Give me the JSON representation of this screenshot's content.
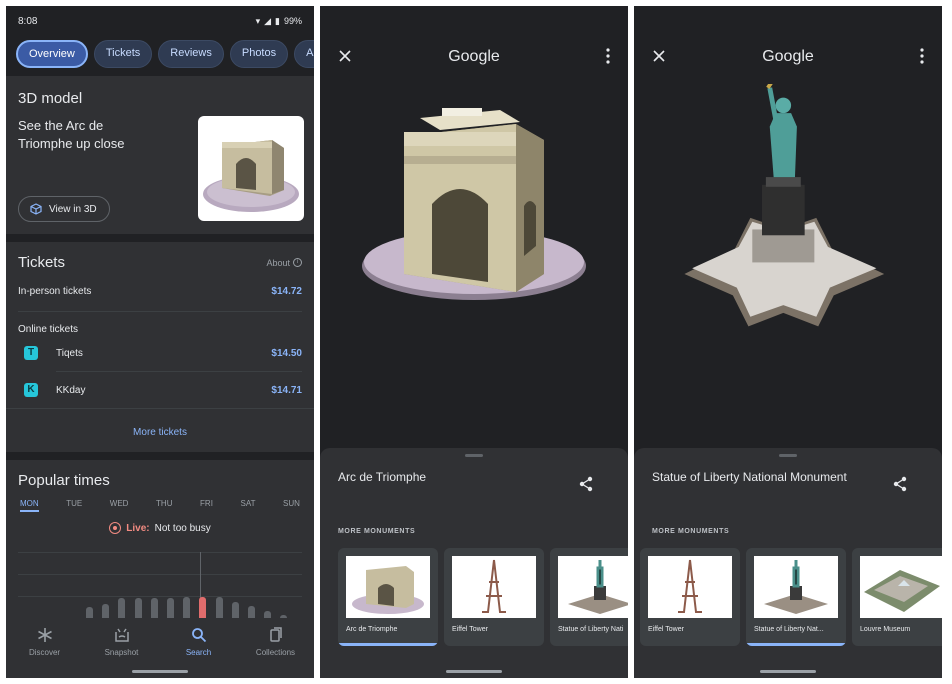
{
  "screen1": {
    "status": {
      "time": "8:08",
      "battery": "99%"
    },
    "chips": [
      "Overview",
      "Tickets",
      "Reviews",
      "Photos",
      "Abo"
    ],
    "model_card": {
      "title": "3D model",
      "description": "See the Arc de Triomphe up close",
      "button_label": "View in 3D"
    },
    "tickets": {
      "title": "Tickets",
      "about_label": "About",
      "in_person_label": "In-person tickets",
      "in_person_price": "$14.72",
      "online_label": "Online tickets",
      "vendors": [
        {
          "name": "Tiqets",
          "price": "$14.50",
          "logo": "T"
        },
        {
          "name": "KKday",
          "price": "$14.71",
          "logo": "K"
        }
      ],
      "more_label": "More tickets"
    },
    "popular_times": {
      "title": "Popular times",
      "days": [
        "MON",
        "TUE",
        "WED",
        "THU",
        "FRI",
        "SAT",
        "SUN"
      ],
      "selected_day": "MON",
      "live_label": "Live:",
      "live_status": "Not too busy",
      "hourly_levels": [
        0.35,
        0.45,
        0.6,
        0.6,
        0.6,
        0.6,
        0.65,
        0.65,
        0.65,
        0.5,
        0.4,
        0.25,
        0.15
      ],
      "current_index": 7,
      "current_color": "#e06c6c"
    },
    "nav": [
      {
        "label": "Discover",
        "icon": "asterisk-icon"
      },
      {
        "label": "Snapshot",
        "icon": "snapshot-icon"
      },
      {
        "label": "Search",
        "icon": "search-icon"
      },
      {
        "label": "Collections",
        "icon": "collections-icon"
      }
    ],
    "active_nav": "Search"
  },
  "screen2": {
    "logo": "Google",
    "title": "Arc de Triomphe",
    "more_label": "MORE MONUMENTS",
    "monuments": [
      "Arc de Triomphe",
      "Eiffel Tower",
      "Statue of Liberty Nati"
    ],
    "selected_index": 0
  },
  "screen3": {
    "logo": "Google",
    "title": "Statue of Liberty National Monument",
    "more_label": "MORE MONUMENTS",
    "monuments": [
      "Eiffel Tower",
      "Statue of Liberty Nat...",
      "Louvre Museum"
    ],
    "selected_index": 1
  },
  "colors": {
    "background": "#202124",
    "card": "#303134",
    "accent": "#8ab4f8",
    "live": "#f28b82"
  }
}
